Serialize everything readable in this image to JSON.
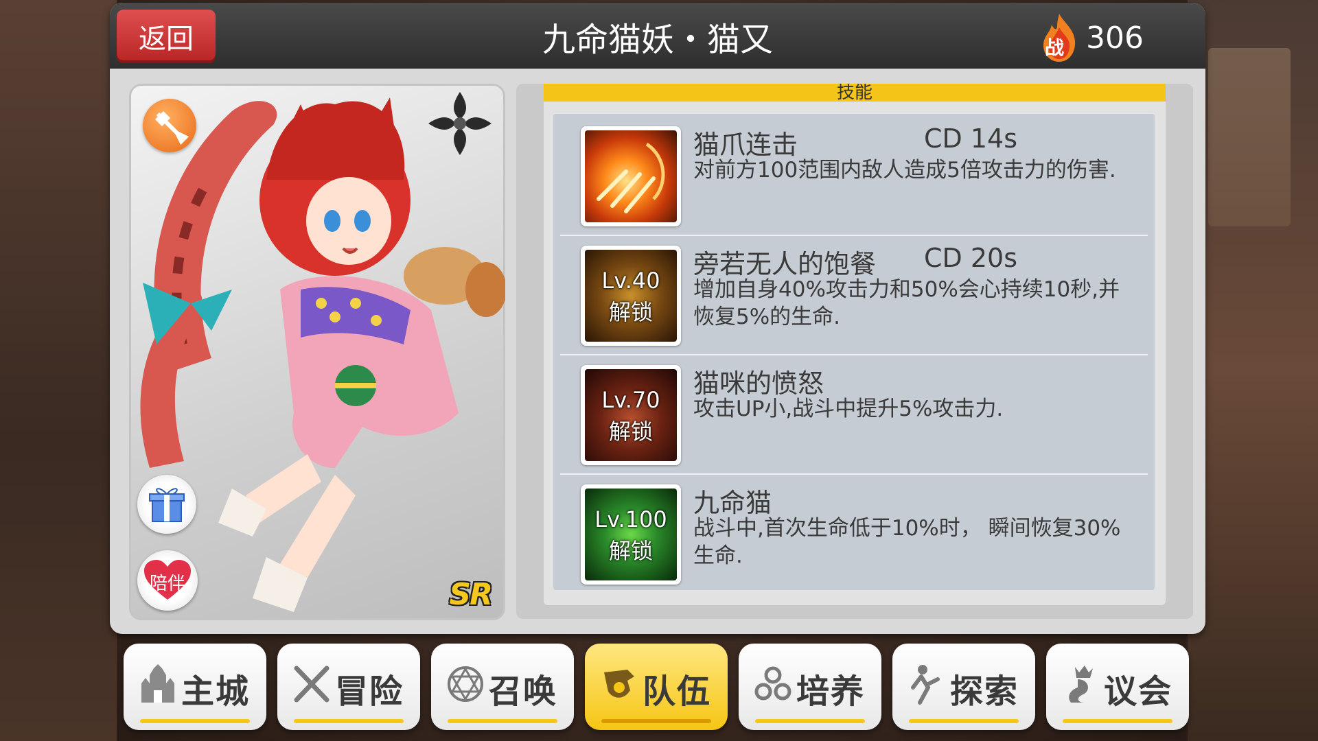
{
  "header": {
    "back_label": "返回",
    "title": "九命猫妖・猫又",
    "power_badge": "战",
    "power_value": "306"
  },
  "card": {
    "rarity": "SR",
    "companion_label": "陪伴"
  },
  "skills": {
    "header": "技能",
    "items": [
      {
        "name": "猫爪连击",
        "cd": "CD  14s",
        "desc": "对前方100范围内敌人造成5倍攻击力的伤害.",
        "lock_level": "",
        "lock_text": ""
      },
      {
        "name": "旁若无人的饱餐",
        "cd": "CD  20s",
        "desc": "增加自身40%攻击力和50%会心持续10秒,并恢复5%的生命.",
        "lock_level": "Lv.40",
        "lock_text": "解锁"
      },
      {
        "name": "猫咪的愤怒",
        "cd": "",
        "desc": "攻击UP小,战斗中提升5%攻击力.",
        "lock_level": "Lv.70",
        "lock_text": "解锁"
      },
      {
        "name": "九命猫",
        "cd": "",
        "desc": "战斗中,首次生命低于10%时， 瞬间恢复30%生命.",
        "lock_level": "Lv.100",
        "lock_text": "解锁"
      }
    ]
  },
  "nav": {
    "items": [
      {
        "label": "主城",
        "icon": "castle-icon"
      },
      {
        "label": "冒险",
        "icon": "crossed-swords-icon"
      },
      {
        "label": "召唤",
        "icon": "hexagram-icon"
      },
      {
        "label": "队伍",
        "icon": "team-icon",
        "active": true
      },
      {
        "label": "培养",
        "icon": "cultivate-icon"
      },
      {
        "label": "探索",
        "icon": "explore-icon"
      },
      {
        "label": "议会",
        "icon": "council-icon"
      }
    ]
  },
  "colors": {
    "accent_yellow": "#f6c614",
    "back_red": "#d03434",
    "panel_gray": "#d9d9d9"
  }
}
